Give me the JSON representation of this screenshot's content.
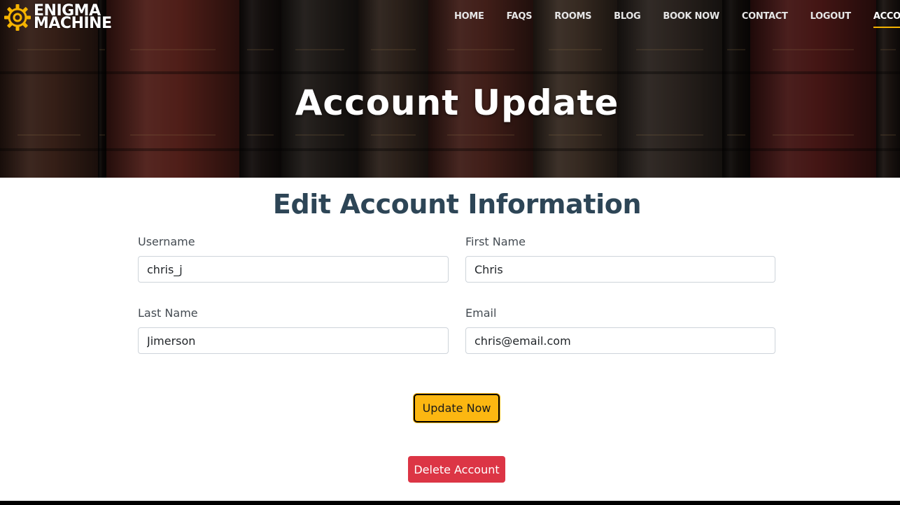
{
  "brand": {
    "line1": "ENIGMA",
    "line2": "MACHINE",
    "accent_color": "#f5b301"
  },
  "nav": {
    "items": [
      {
        "label": "HOME"
      },
      {
        "label": "FAQS"
      },
      {
        "label": "ROOMS"
      },
      {
        "label": "BLOG"
      },
      {
        "label": "BOOK NOW"
      },
      {
        "label": "CONTACT"
      },
      {
        "label": "LOGOUT"
      },
      {
        "label": "ACCOUNT",
        "active": true
      }
    ]
  },
  "hero": {
    "title": "Account Update"
  },
  "form": {
    "heading": "Edit Account Information",
    "username": {
      "label": "Username",
      "value": "chris_j"
    },
    "first_name": {
      "label": "First Name",
      "value": "Chris"
    },
    "last_name": {
      "label": "Last Name",
      "value": "Jimerson"
    },
    "email": {
      "label": "Email",
      "value": "chris@email.com"
    },
    "update_label": "Update Now",
    "delete_label": "Delete Account"
  },
  "colors": {
    "update_button": "#fcb711",
    "delete_button": "#dc3545",
    "heading": "#2d4556"
  }
}
